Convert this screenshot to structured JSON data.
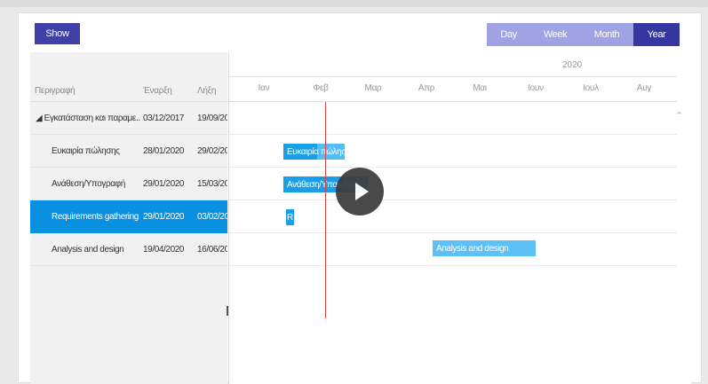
{
  "toolbar": {
    "show_label": "Show"
  },
  "view_tabs": [
    {
      "label": "Day",
      "active": false
    },
    {
      "label": "Week",
      "active": false
    },
    {
      "label": "Month",
      "active": false
    },
    {
      "label": "Year",
      "active": true
    }
  ],
  "grid": {
    "headers": {
      "description": "Περιγραφή",
      "start": "Έναρξη",
      "end": "Λήξη"
    },
    "rows": [
      {
        "description": "◢ Εγκατάσταση και παραμε...",
        "start": "03/12/2017",
        "end": "19/09/20",
        "selected": false
      },
      {
        "description": "Ευκαιρία πώλησης",
        "start": "28/01/2020",
        "end": "29/02/20",
        "selected": false
      },
      {
        "description": "Ανάθεση/Υπογραφή",
        "start": "29/01/2020",
        "end": "15/03/20",
        "selected": false
      },
      {
        "description": "Requirements gathering",
        "start": "29/01/2020",
        "end": "03/02/20",
        "selected": true
      },
      {
        "description": "Analysis and design",
        "start": "19/04/2020",
        "end": "16/06/20",
        "selected": false
      }
    ]
  },
  "timeline": {
    "year": "2020",
    "months": [
      "Ιαν",
      "Φεβ",
      "Μαρ",
      "Απρ",
      "Μαι",
      "Ιουν",
      "Ιουλ",
      "Αυγ"
    ],
    "bars": [
      {
        "row": 1,
        "label": "Ευκαιρία πώλησης",
        "progress": 0.45
      },
      {
        "row": 2,
        "label": "Ανάθεση/Υπογραφή",
        "progress": 0.3
      },
      {
        "row": 3,
        "label": "R",
        "progress": 0
      },
      {
        "row": 4,
        "label": "Analysis and design",
        "progress": 0
      }
    ]
  },
  "colors": {
    "accent": "#3f3fa8",
    "tab_inactive": "#9fa3e3",
    "selected_row": "#0a90e0",
    "bar": "#1a9ee8",
    "today_line": "#d84040"
  },
  "icons": {
    "play": "play-icon",
    "collapse": "chevron-up-icon"
  }
}
